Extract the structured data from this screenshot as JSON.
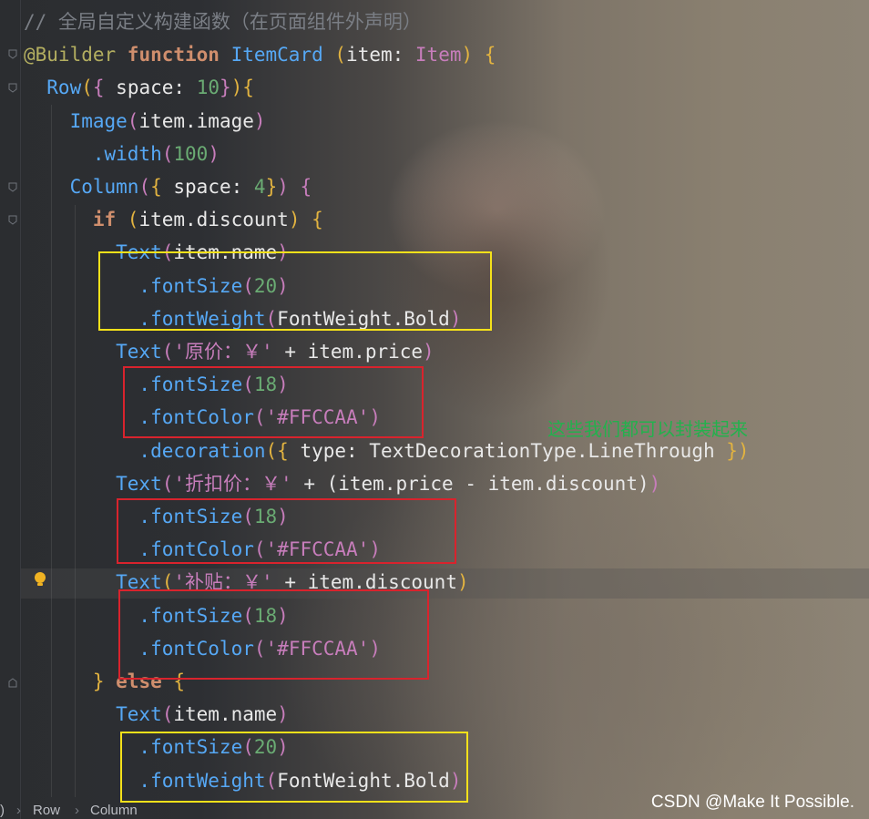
{
  "editor": {
    "lines": [
      {
        "segments": [
          {
            "t": "// 全局自定义构建函数（在页面组件外声明）",
            "c": "c-comment"
          }
        ]
      },
      {
        "segments": [
          {
            "t": "@Builder ",
            "c": "c-ann"
          },
          {
            "t": "function ",
            "c": "c-kw"
          },
          {
            "t": "ItemCard ",
            "c": "c-fn"
          },
          {
            "t": "(",
            "c": "c-punc"
          },
          {
            "t": "item: ",
            "c": "c-plain"
          },
          {
            "t": "Item",
            "c": "c-type"
          },
          {
            "t": ") {",
            "c": "c-punc"
          }
        ]
      },
      {
        "segments": [
          {
            "t": "  Row",
            "c": "c-cls"
          },
          {
            "t": "(",
            "c": "c-punc"
          },
          {
            "t": "{ ",
            "c": "c-paren"
          },
          {
            "t": "space: ",
            "c": "c-plain"
          },
          {
            "t": "10",
            "c": "c-num"
          },
          {
            "t": "}",
            "c": "c-paren"
          },
          {
            "t": "){",
            "c": "c-punc"
          }
        ]
      },
      {
        "segments": [
          {
            "t": "    Image",
            "c": "c-cls"
          },
          {
            "t": "(",
            "c": "c-paren"
          },
          {
            "t": "item.image",
            "c": "c-plain"
          },
          {
            "t": ")",
            "c": "c-paren"
          }
        ]
      },
      {
        "segments": [
          {
            "t": "      .width",
            "c": "c-meth"
          },
          {
            "t": "(",
            "c": "c-paren"
          },
          {
            "t": "100",
            "c": "c-num"
          },
          {
            "t": ")",
            "c": "c-paren"
          }
        ]
      },
      {
        "segments": [
          {
            "t": "    Column",
            "c": "c-cls"
          },
          {
            "t": "(",
            "c": "c-paren"
          },
          {
            "t": "{ ",
            "c": "c-punc"
          },
          {
            "t": "space: ",
            "c": "c-plain"
          },
          {
            "t": "4",
            "c": "c-num"
          },
          {
            "t": "}",
            "c": "c-punc"
          },
          {
            "t": ") {",
            "c": "c-paren"
          }
        ]
      },
      {
        "segments": [
          {
            "t": "      if ",
            "c": "c-kw"
          },
          {
            "t": "(",
            "c": "c-punc"
          },
          {
            "t": "item.discount",
            "c": "c-plain"
          },
          {
            "t": ") {",
            "c": "c-punc"
          }
        ]
      },
      {
        "segments": [
          {
            "t": "        Text",
            "c": "c-cls"
          },
          {
            "t": "(",
            "c": "c-paren"
          },
          {
            "t": "item.name",
            "c": "c-plain"
          },
          {
            "t": ")",
            "c": "c-paren"
          }
        ]
      },
      {
        "segments": [
          {
            "t": "          .fontSize",
            "c": "c-meth"
          },
          {
            "t": "(",
            "c": "c-paren"
          },
          {
            "t": "20",
            "c": "c-num"
          },
          {
            "t": ")",
            "c": "c-paren"
          }
        ]
      },
      {
        "segments": [
          {
            "t": "          .fontWeight",
            "c": "c-meth"
          },
          {
            "t": "(",
            "c": "c-paren"
          },
          {
            "t": "FontWeight.Bold",
            "c": "c-plain"
          },
          {
            "t": ")",
            "c": "c-paren"
          }
        ]
      },
      {
        "segments": [
          {
            "t": "        Text",
            "c": "c-cls"
          },
          {
            "t": "(",
            "c": "c-paren"
          },
          {
            "t": "'原价：￥'",
            "c": "c-str"
          },
          {
            "t": " + item.price",
            "c": "c-plain"
          },
          {
            "t": ")",
            "c": "c-paren"
          }
        ]
      },
      {
        "segments": [
          {
            "t": "          .fontSize",
            "c": "c-meth"
          },
          {
            "t": "(",
            "c": "c-paren"
          },
          {
            "t": "18",
            "c": "c-num"
          },
          {
            "t": ")",
            "c": "c-paren"
          }
        ]
      },
      {
        "segments": [
          {
            "t": "          .fontColor",
            "c": "c-meth"
          },
          {
            "t": "(",
            "c": "c-paren"
          },
          {
            "t": "'#FFCCAA'",
            "c": "c-str"
          },
          {
            "t": ")",
            "c": "c-paren"
          }
        ]
      },
      {
        "segments": [
          {
            "t": "          .decoration",
            "c": "c-meth"
          },
          {
            "t": "({ ",
            "c": "c-punc"
          },
          {
            "t": "type: TextDecorationType.LineThrough ",
            "c": "c-plain"
          },
          {
            "t": "})",
            "c": "c-punc"
          }
        ]
      },
      {
        "segments": [
          {
            "t": "        Text",
            "c": "c-cls"
          },
          {
            "t": "(",
            "c": "c-paren"
          },
          {
            "t": "'折扣价：￥'",
            "c": "c-str"
          },
          {
            "t": " + (item.price - item.discount)",
            "c": "c-plain"
          },
          {
            "t": ")",
            "c": "c-paren"
          }
        ]
      },
      {
        "segments": [
          {
            "t": "          .fontSize",
            "c": "c-meth"
          },
          {
            "t": "(",
            "c": "c-paren"
          },
          {
            "t": "18",
            "c": "c-num"
          },
          {
            "t": ")",
            "c": "c-paren"
          }
        ]
      },
      {
        "segments": [
          {
            "t": "          .fontColor",
            "c": "c-meth"
          },
          {
            "t": "(",
            "c": "c-paren"
          },
          {
            "t": "'#FFCCAA'",
            "c": "c-str"
          },
          {
            "t": ")",
            "c": "c-paren"
          }
        ]
      },
      {
        "segments": [
          {
            "t": "        Text",
            "c": "c-cls"
          },
          {
            "t": "(",
            "c": "c-punc"
          },
          {
            "t": "'补贴：￥'",
            "c": "c-str"
          },
          {
            "t": " + item.discount",
            "c": "c-plain"
          },
          {
            "t": ")",
            "c": "c-punc"
          }
        ]
      },
      {
        "segments": [
          {
            "t": "          .fontSize",
            "c": "c-meth"
          },
          {
            "t": "(",
            "c": "c-paren"
          },
          {
            "t": "18",
            "c": "c-num"
          },
          {
            "t": ")",
            "c": "c-paren"
          }
        ]
      },
      {
        "segments": [
          {
            "t": "          .fontColor",
            "c": "c-meth"
          },
          {
            "t": "(",
            "c": "c-paren"
          },
          {
            "t": "'#FFCCAA'",
            "c": "c-str"
          },
          {
            "t": ")",
            "c": "c-paren"
          }
        ]
      },
      {
        "segments": [
          {
            "t": "      } ",
            "c": "c-punc"
          },
          {
            "t": "else ",
            "c": "c-kw"
          },
          {
            "t": "{",
            "c": "c-punc"
          }
        ]
      },
      {
        "segments": [
          {
            "t": "        Text",
            "c": "c-cls"
          },
          {
            "t": "(",
            "c": "c-paren"
          },
          {
            "t": "item.name",
            "c": "c-plain"
          },
          {
            "t": ")",
            "c": "c-paren"
          }
        ]
      },
      {
        "segments": [
          {
            "t": "          .fontSize",
            "c": "c-meth"
          },
          {
            "t": "(",
            "c": "c-paren"
          },
          {
            "t": "20",
            "c": "c-num"
          },
          {
            "t": ")",
            "c": "c-paren"
          }
        ]
      },
      {
        "segments": [
          {
            "t": "          .fontWeight",
            "c": "c-meth"
          },
          {
            "t": "(",
            "c": "c-paren"
          },
          {
            "t": "FontWeight.Bold",
            "c": "c-plain"
          },
          {
            "t": ")",
            "c": "c-paren"
          }
        ]
      }
    ]
  },
  "annotation": "这些我们都可以封装起来",
  "watermark": "CSDN @Make It Possible.",
  "breadcrumb": {
    "lead": ")",
    "items": [
      "Row",
      "Column"
    ]
  },
  "icons": {
    "fold": "fold-marker-icon",
    "bulb": "intention-bulb-icon"
  },
  "colors": {
    "yellow_box": "#f5e11a",
    "red_box": "#d9232d",
    "annotation": "#23b14d"
  }
}
